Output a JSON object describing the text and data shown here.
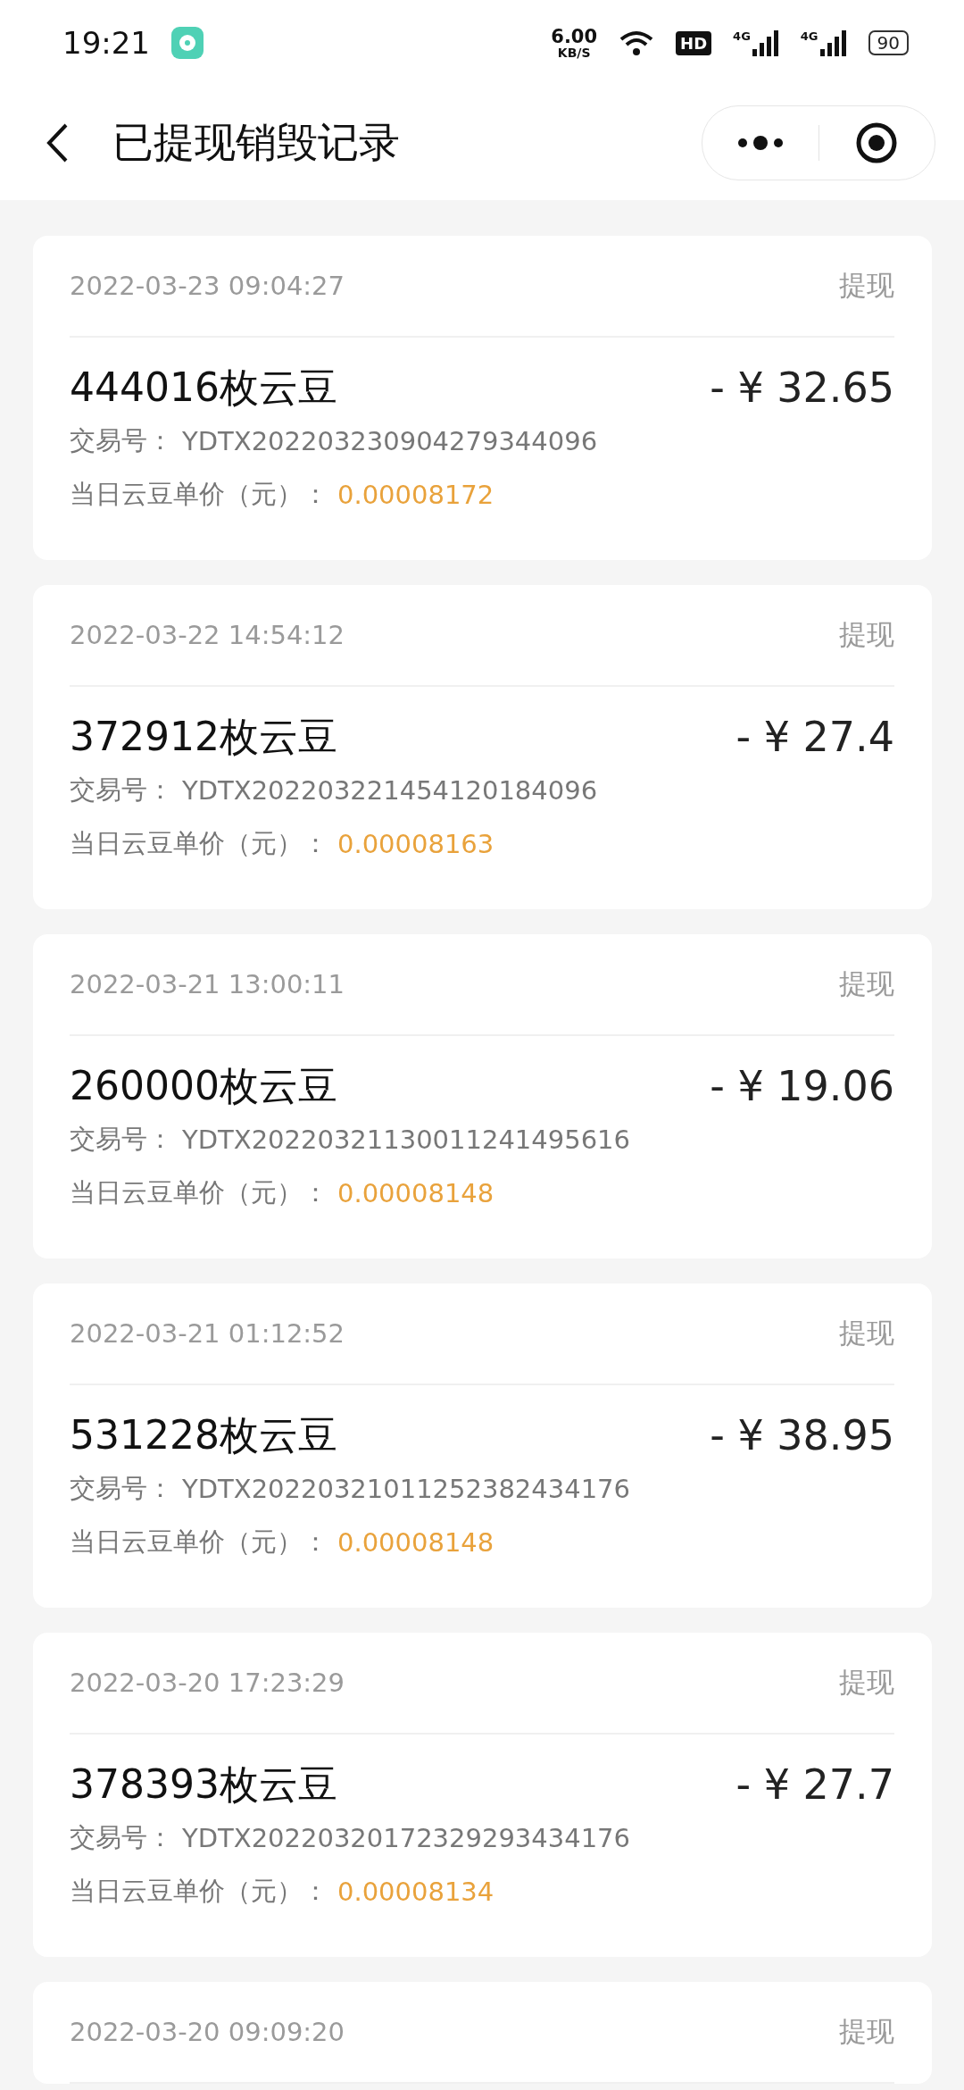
{
  "status_bar": {
    "time": "19:21",
    "speed": "6.00",
    "speed_unit": "KB/S",
    "hd": "HD",
    "signals": [
      "4G",
      "4G"
    ],
    "battery": "90"
  },
  "header": {
    "title": "已提现销毁记录"
  },
  "records": [
    {
      "date": "2022-03-23 09:04:27",
      "type": "提现",
      "beans": "444016枚云豆",
      "amount": "- ¥ 32.65",
      "tx_label": "交易号：",
      "tx_no": "YDTX202203230904279344096",
      "price_label": "当日云豆单价（元）：",
      "price": "0.00008172"
    },
    {
      "date": "2022-03-22 14:54:12",
      "type": "提现",
      "beans": "372912枚云豆",
      "amount": "- ¥ 27.4",
      "tx_label": "交易号：",
      "tx_no": "YDTX20220322145412018409​6",
      "price_label": "当日云豆单价（元）：",
      "price": "0.00008163"
    },
    {
      "date": "2022-03-21 13:00:11",
      "type": "提现",
      "beans": "260000枚云豆",
      "amount": "- ¥ 19.06",
      "tx_label": "交易号：",
      "tx_no": "YDTX20220321130011241495616",
      "price_label": "当日云豆单价（元）：",
      "price": "0.00008148"
    },
    {
      "date": "2022-03-21 01:12:52",
      "type": "提现",
      "beans": "531228枚云豆",
      "amount": "- ¥ 38.95",
      "tx_label": "交易号：",
      "tx_no": "YDTX20220321011252382434176",
      "price_label": "当日云豆单价（元）：",
      "price": "0.00008148"
    },
    {
      "date": "2022-03-20 17:23:29",
      "type": "提现",
      "beans": "378393枚云豆",
      "amount": "- ¥ 27.7",
      "tx_label": "交易号：",
      "tx_no": "YDTX20220320172329293434176",
      "price_label": "当日云豆单价（元）：",
      "price": "0.00008134"
    },
    {
      "date": "2022-03-20 09:09:20",
      "type": "提现"
    }
  ]
}
